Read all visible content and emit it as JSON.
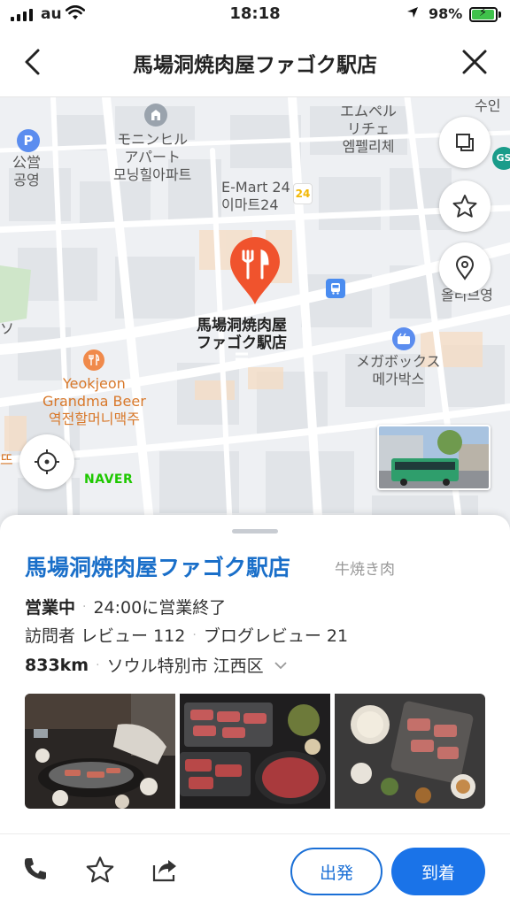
{
  "status_bar": {
    "carrier": "au",
    "time": "18:18",
    "battery": "98%",
    "icons": [
      "signal-icon",
      "wifi-icon",
      "location-arrow-icon",
      "battery-charging-icon"
    ]
  },
  "nav": {
    "title": "馬場洞焼肉屋ファゴク駅店",
    "back_icon": "chevron-left-icon",
    "close_icon": "close-icon"
  },
  "map": {
    "labels": {
      "parking_1": "公営",
      "parking_2": "공영",
      "mony_1": "モニンヒル",
      "mony_2": "アパート",
      "mony_3": "모닝힐아파트",
      "emp_1": "エムペル",
      "emp_2": "リチェ",
      "emp_3": "엠펠리체",
      "suwin": "수인",
      "emart_1": "E-Mart 24",
      "emart_2": "이마트24",
      "emart_badge": "24",
      "pin_1": "馬場洞焼肉屋",
      "pin_2": "ファゴク駅店",
      "yeok_1": "Yeokjeon",
      "yeok_2": "Grandma Beer",
      "yeok_3": "역전할머니맥주",
      "mega_1": "メガボックス",
      "mega_2": "메가박스",
      "olive": "올리브영",
      "gs": "GS",
      "so": "ソ",
      "ddeu": "뜨",
      "parking_letter": "P"
    },
    "naver_logo": "NAVER"
  },
  "place": {
    "name": "馬場洞焼肉屋ファゴク駅店",
    "category": "牛焼き肉",
    "status": "営業中",
    "hours": "24:00に営業終了",
    "visitor_reviews": "訪問者 レビュー 112",
    "blog_reviews": "ブログレビュー 21",
    "distance": "833km",
    "address": "ソウル特別市 江西区"
  },
  "actions": {
    "depart_label": "出発",
    "arrive_label": "到着"
  },
  "colors": {
    "accent": "#1a73e8",
    "pin": "#f0532d",
    "naver": "#1ec800",
    "place_name": "#1a6fc9"
  }
}
